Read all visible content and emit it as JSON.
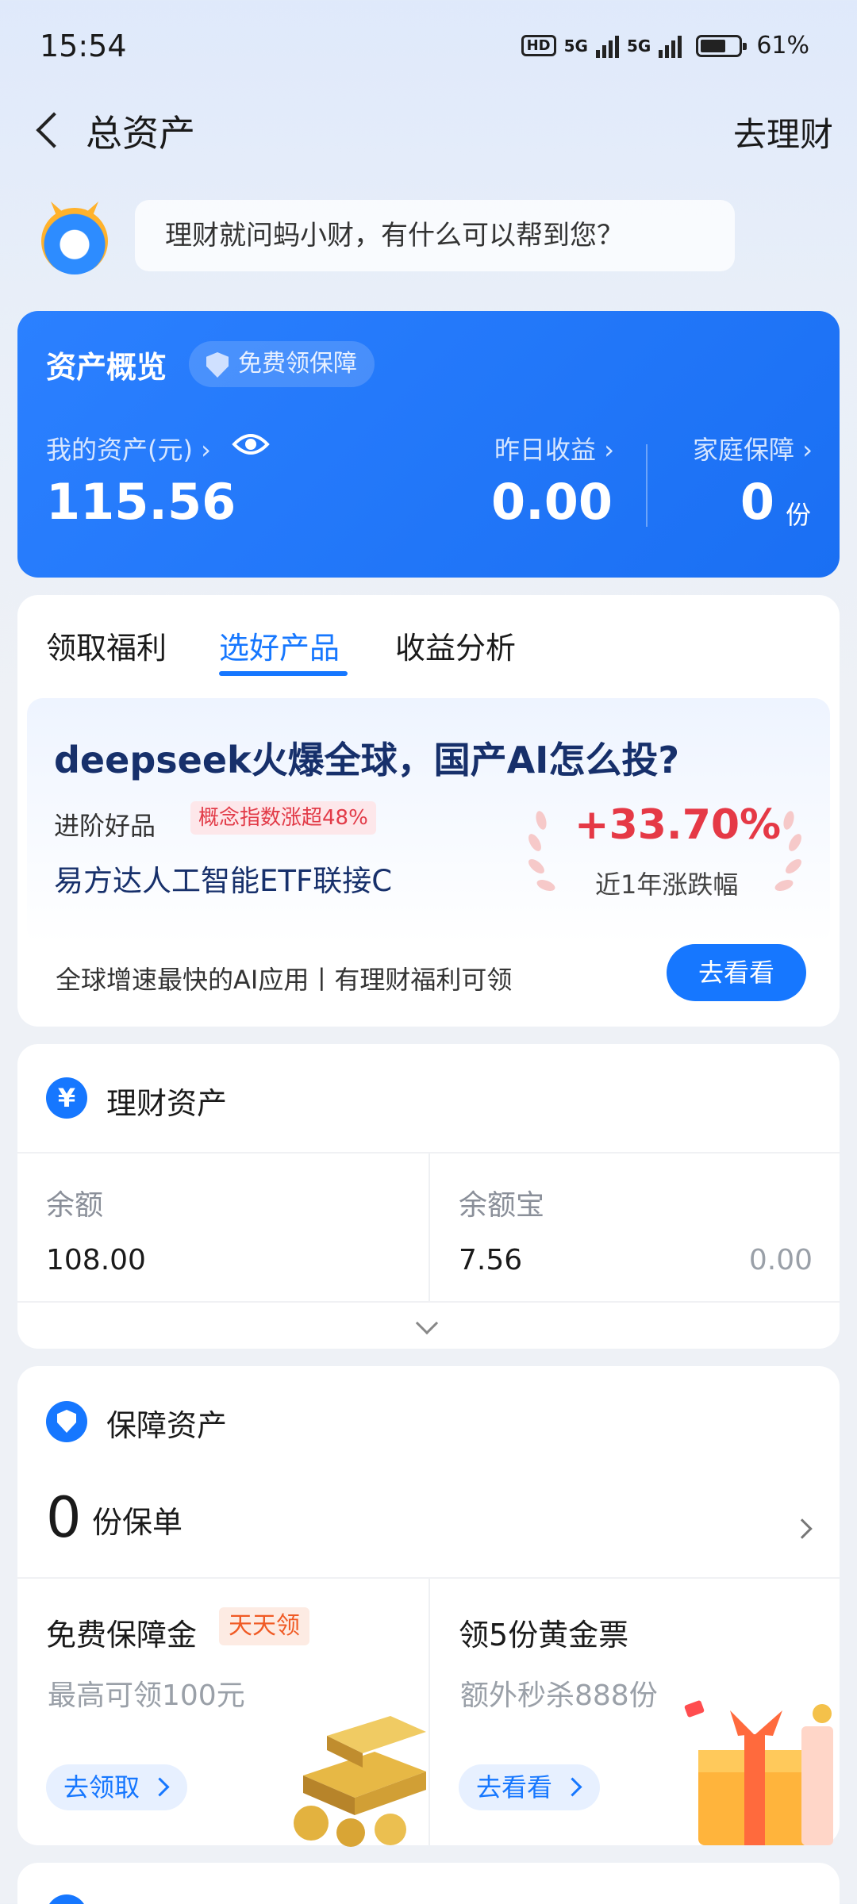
{
  "status": {
    "time": "15:54",
    "hd": "HD",
    "net1": "5G",
    "net2": "5G",
    "battery": "61%"
  },
  "header": {
    "title": "总资产",
    "right_link": "去理财"
  },
  "assistant": {
    "prompt": "理财就问蚂小财，有什么可以帮到您？"
  },
  "overview": {
    "title": "资产概览",
    "badge": "免费领保障",
    "assets_label": "我的资产(元) ›",
    "assets_value": "115.56",
    "yesterday_label": "昨日收益 ›",
    "yesterday_value": "0.00",
    "family_label": "家庭保障 ›",
    "family_value": "0",
    "family_unit": "份"
  },
  "tabs": [
    {
      "label": "领取福利",
      "active": false
    },
    {
      "label": "选好产品",
      "active": true
    },
    {
      "label": "收益分析",
      "active": false
    }
  ],
  "promo": {
    "title": "deepseek火爆全球，国产AI怎么投?",
    "sub_label": "进阶好品",
    "tag": "概念指数涨超48%",
    "fund_name": "易方达人工智能ETF联接C",
    "pct": "+33.70%",
    "pct_label": "近1年涨跌幅",
    "footer": "全球增速最快的AI应用丨有理财福利可领",
    "button": "去看看"
  },
  "wealth": {
    "title": "理财资产",
    "icon": "yen-icon",
    "cells": [
      {
        "label": "余额",
        "value": "108.00"
      },
      {
        "label": "余额宝",
        "value": "7.56",
        "extra": "0.00"
      }
    ]
  },
  "protection": {
    "title": "保障资产",
    "count": "0",
    "count_label": "份保单",
    "left": {
      "title": "免费保障金",
      "tag": "天天领",
      "subtitle": "最高可领100元",
      "button": "去领取"
    },
    "right": {
      "title": "领5份黄金票",
      "subtitle": "额外秒杀888份",
      "button": "去看看"
    }
  },
  "colors": {
    "accent": "#1677ff",
    "overview_bg": "#2b80ff",
    "gain_red": "#e53946",
    "tag_orange": "#f05a24"
  }
}
